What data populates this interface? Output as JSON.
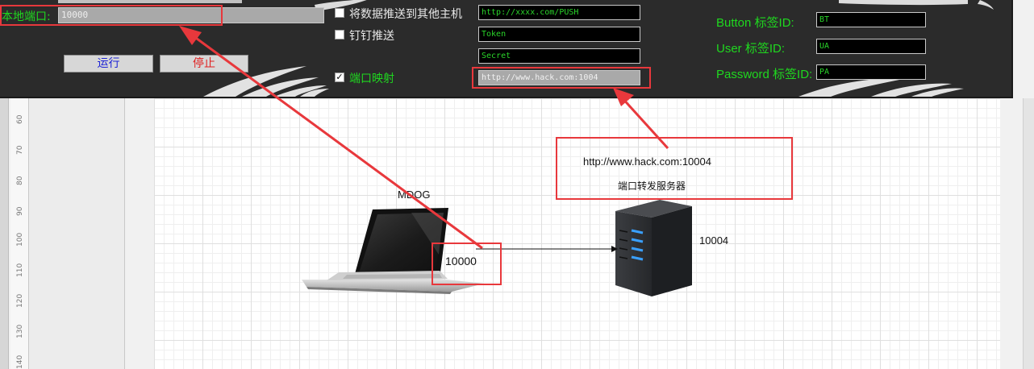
{
  "tool": {
    "local_port_label": "本地端口:",
    "local_port_value": "10000",
    "run_button": "运行",
    "stop_button": "停止",
    "push_other_hosts": "将数据推送到其他主机",
    "dingtalk_push": "钉钉推送",
    "port_mapping": "端口映射",
    "push_url": "http://xxxx.com/PUSH",
    "token": "Token",
    "secret": "Secret",
    "mapping_url": "http://www.hack.com:1004",
    "button_tag_label": "Button 标签ID:",
    "button_tag_value": "BT",
    "user_tag_label": "User 标签ID:",
    "user_tag_value": "UA",
    "password_tag_label": "Password 标签ID:",
    "password_tag_value": "PA",
    "checkboxes": {
      "push_other_hosts": false,
      "dingtalk_push": false,
      "port_mapping": true
    }
  },
  "ruler": {
    "ticks": [
      "60",
      "70",
      "80",
      "90",
      "100",
      "110",
      "120",
      "130",
      "140"
    ]
  },
  "diagram": {
    "laptop_label": "MDOG",
    "port_label": "10000",
    "server_url": "http://www.hack.com:10004",
    "server_label": "端口转发服务器",
    "server_port": "10004"
  },
  "colors": {
    "accent_green": "#1fd81f",
    "annotation_red": "#e8383c",
    "window_bg": "#2b2b2b"
  }
}
